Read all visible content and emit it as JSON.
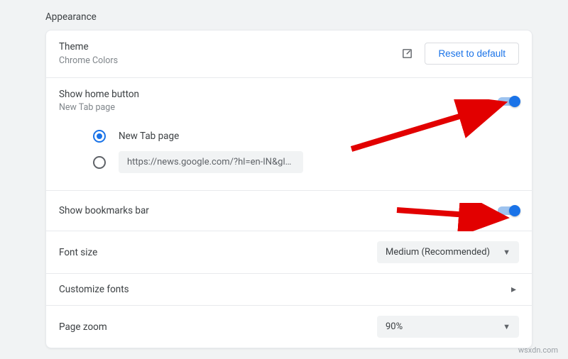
{
  "section": {
    "title": "Appearance"
  },
  "theme": {
    "title": "Theme",
    "subtitle": "Chrome Colors",
    "reset_button": "Reset to default"
  },
  "home_button": {
    "title": "Show home button",
    "subtitle": "New Tab page",
    "radio_newtab_label": "New Tab page",
    "radio_custom_url": "https://news.google.com/?hl=en-IN&gl=IN&c..."
  },
  "bookmarks_bar": {
    "title": "Show bookmarks bar"
  },
  "font_size": {
    "title": "Font size",
    "selected": "Medium (Recommended)"
  },
  "customize_fonts": {
    "title": "Customize fonts"
  },
  "page_zoom": {
    "title": "Page zoom",
    "selected": "90%"
  },
  "watermark": "wsxdn.com"
}
